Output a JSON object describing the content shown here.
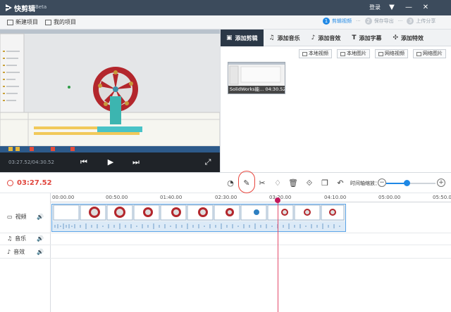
{
  "app": {
    "name": "快剪辑",
    "badge": "Beta",
    "login": "登录"
  },
  "toolbar": {
    "new_project": "新建项目",
    "my_projects": "我的项目"
  },
  "steps": [
    {
      "num": "1",
      "label": "剪辑视频"
    },
    {
      "num": "2",
      "label": "保存导出"
    },
    {
      "num": "3",
      "label": "上传分享"
    }
  ],
  "player": {
    "time": "03:27.52/04:30.52"
  },
  "library": {
    "tabs": [
      {
        "label": "添加剪辑",
        "icon": "film-icon"
      },
      {
        "label": "添加音乐",
        "icon": "music-icon"
      },
      {
        "label": "添加音效",
        "icon": "sound-effect-icon"
      },
      {
        "label": "添加字幕",
        "icon": "text-icon"
      },
      {
        "label": "添加特效",
        "icon": "effects-icon"
      }
    ],
    "buttons": [
      "本地视频",
      "本地图片",
      "网络视频",
      "网络图片"
    ],
    "clip": {
      "name": "SolidWorks能...",
      "duration": "04:30.52"
    }
  },
  "edit": {
    "current_time": "03:27.52",
    "zoom_label": "时间轴缩放：",
    "zoom_level": 0.41
  },
  "timeline": {
    "ticks": [
      "00:00.00",
      "00:50.00",
      "01:40.00",
      "02:30.00",
      "03:20.00",
      "04:10.00",
      "05:00.00",
      "05:50.00"
    ],
    "tracks": [
      {
        "label": "视频"
      },
      {
        "label": "音乐"
      },
      {
        "label": "音效"
      }
    ]
  },
  "colors": {
    "accent": "#1e88e5",
    "current_time": "#e0443c",
    "playhead": "#c2185b",
    "titlebar": "#3c4b5c"
  }
}
